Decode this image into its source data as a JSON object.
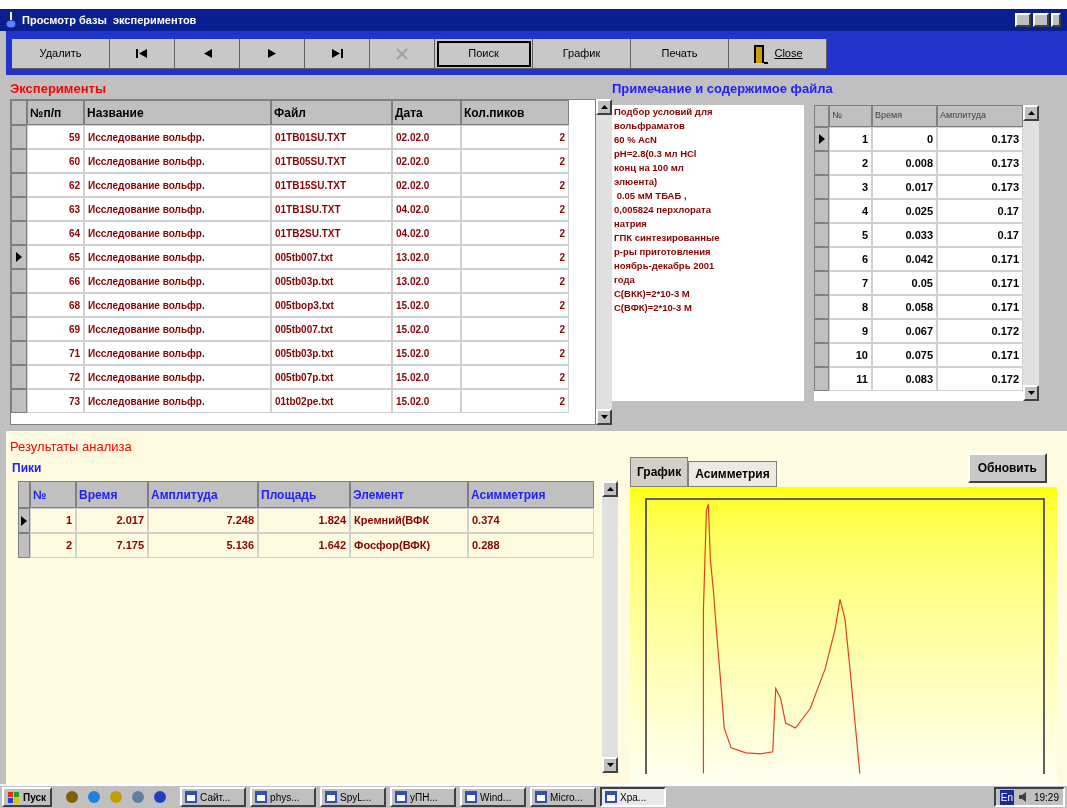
{
  "window": {
    "title": "Просмотр базы  экспериментов"
  },
  "toolbar": [
    {
      "kind": "text",
      "label": "Удалить",
      "disabled": false,
      "default": false
    },
    {
      "kind": "first",
      "disabled": false,
      "default": false
    },
    {
      "kind": "prev",
      "disabled": false,
      "default": false
    },
    {
      "kind": "next",
      "disabled": false,
      "default": false
    },
    {
      "kind": "last",
      "disabled": false,
      "default": false
    },
    {
      "kind": "cancel",
      "disabled": true,
      "default": false
    },
    {
      "kind": "text",
      "label": "Поиск",
      "disabled": false,
      "default": true
    },
    {
      "kind": "text",
      "label": "График",
      "disabled": false,
      "default": false
    },
    {
      "kind": "text",
      "label": "Печать",
      "disabled": false,
      "default": false
    },
    {
      "kind": "close",
      "label": "Close",
      "disabled": false,
      "default": false
    }
  ],
  "experiments": {
    "title": "Эксперименты",
    "columns": [
      "№п/п",
      "Название",
      "Файл",
      "Дата",
      "Кол.пиков"
    ],
    "rows": [
      {
        "cells": [
          "59",
          "Исследование вольфр.",
          "01TB01SU.TXT",
          "02.02.0",
          "2"
        ],
        "selected": false
      },
      {
        "cells": [
          "60",
          "Исследование вольфр.",
          "01TB05SU.TXT",
          "02.02.0",
          "2"
        ],
        "selected": false
      },
      {
        "cells": [
          "62",
          "Исследование вольфр.",
          "01TB15SU.TXT",
          "02.02.0",
          "2"
        ],
        "selected": false
      },
      {
        "cells": [
          "63",
          "Исследование вольфр.",
          "01TB1SU.TXT",
          "04.02.0",
          "2"
        ],
        "selected": false
      },
      {
        "cells": [
          "64",
          "Исследование вольфр.",
          "01TB2SU.TXT",
          "04.02.0",
          "2"
        ],
        "selected": false
      },
      {
        "cells": [
          "65",
          "Исследование вольфр.",
          "005tb007.txt",
          "13.02.0",
          "2"
        ],
        "selected": true
      },
      {
        "cells": [
          "66",
          "Исследование вольфр.",
          "005tb03p.txt",
          "13.02.0",
          "2"
        ],
        "selected": false
      },
      {
        "cells": [
          "68",
          "Исследование вольфр.",
          "005tbop3.txt",
          "15.02.0",
          "2"
        ],
        "selected": false
      },
      {
        "cells": [
          "69",
          "Исследование вольфр.",
          "005tb007.txt",
          "15.02.0",
          "2"
        ],
        "selected": false
      },
      {
        "cells": [
          "71",
          "Исследование вольфр.",
          "005tb03p.txt",
          "15.02.0",
          "2"
        ],
        "selected": false
      },
      {
        "cells": [
          "72",
          "Исследование вольфр.",
          "005tb07p.txt",
          "15.02.0",
          "2"
        ],
        "selected": false
      },
      {
        "cells": [
          "73",
          "Исследование вольфр.",
          "01tb02pe.txt",
          "15.02.0",
          "2"
        ],
        "selected": false
      }
    ]
  },
  "notes": {
    "title": "Примечание и содержимое файла",
    "lines": [
      "Подбор условий для",
      "вольфраматов",
      "60 % AcN",
      "pH=2.8(0.3 мл HCl",
      "конц на 100 мл",
      "элюента)",
      " 0.05 мМ ТБАБ ,",
      "0,005824 перхлората",
      "натрия",
      "ГПК синтезированные",
      "р-ры приготовления",
      "ноябрь-декабрь 2001",
      "года",
      "С(ВКК)=2*10-3 М",
      "С(ВФК)=2*10-3 М"
    ]
  },
  "file_data": {
    "columns": [
      "№",
      "Время",
      "Амплитуда"
    ],
    "rows": [
      {
        "cells": [
          "1",
          "0",
          "0.173"
        ],
        "selected": true
      },
      {
        "cells": [
          "2",
          "0.008",
          "0.173"
        ],
        "selected": false
      },
      {
        "cells": [
          "3",
          "0.017",
          "0.173"
        ],
        "selected": false
      },
      {
        "cells": [
          "4",
          "0.025",
          "0.17"
        ],
        "selected": false
      },
      {
        "cells": [
          "5",
          "0.033",
          "0.17"
        ],
        "selected": false
      },
      {
        "cells": [
          "6",
          "0.042",
          "0.171"
        ],
        "selected": false
      },
      {
        "cells": [
          "7",
          "0.05",
          "0.171"
        ],
        "selected": false
      },
      {
        "cells": [
          "8",
          "0.058",
          "0.171"
        ],
        "selected": false
      },
      {
        "cells": [
          "9",
          "0.067",
          "0.172"
        ],
        "selected": false
      },
      {
        "cells": [
          "10",
          "0.075",
          "0.171"
        ],
        "selected": false
      },
      {
        "cells": [
          "11",
          "0.083",
          "0.172"
        ],
        "selected": false
      }
    ]
  },
  "results": {
    "title": "Результаты анализа",
    "peaks_title": "Пики",
    "columns": [
      "№",
      "Время",
      "Амплитуда",
      "Площадь",
      "Элемент",
      "Асимметрия"
    ],
    "rows": [
      {
        "cells": [
          "1",
          "2.017",
          "7.248",
          "1.824",
          "Кремний(ВФК",
          "0.374"
        ],
        "selected": true
      },
      {
        "cells": [
          "2",
          "7.175",
          "5.136",
          "1.642",
          "Фосфор(ВФК)",
          "0.288"
        ],
        "selected": false
      }
    ]
  },
  "tabs": [
    {
      "label": "График",
      "selected": true
    },
    {
      "label": "Асимметрия",
      "selected": false
    }
  ],
  "refresh_button": "Обновить",
  "taskbar": {
    "start": "Пуск",
    "tasks": [
      {
        "label": "Сайт...",
        "selected": false
      },
      {
        "label": "phys...",
        "selected": false
      },
      {
        "label": "SpyL...",
        "selected": false
      },
      {
        "label": "уПН...",
        "selected": false
      },
      {
        "label": "Wind...",
        "selected": false
      },
      {
        "label": "Micro...",
        "selected": false
      },
      {
        "label": "Хра...",
        "selected": true
      }
    ],
    "lang": "En",
    "time": "19:29"
  }
}
